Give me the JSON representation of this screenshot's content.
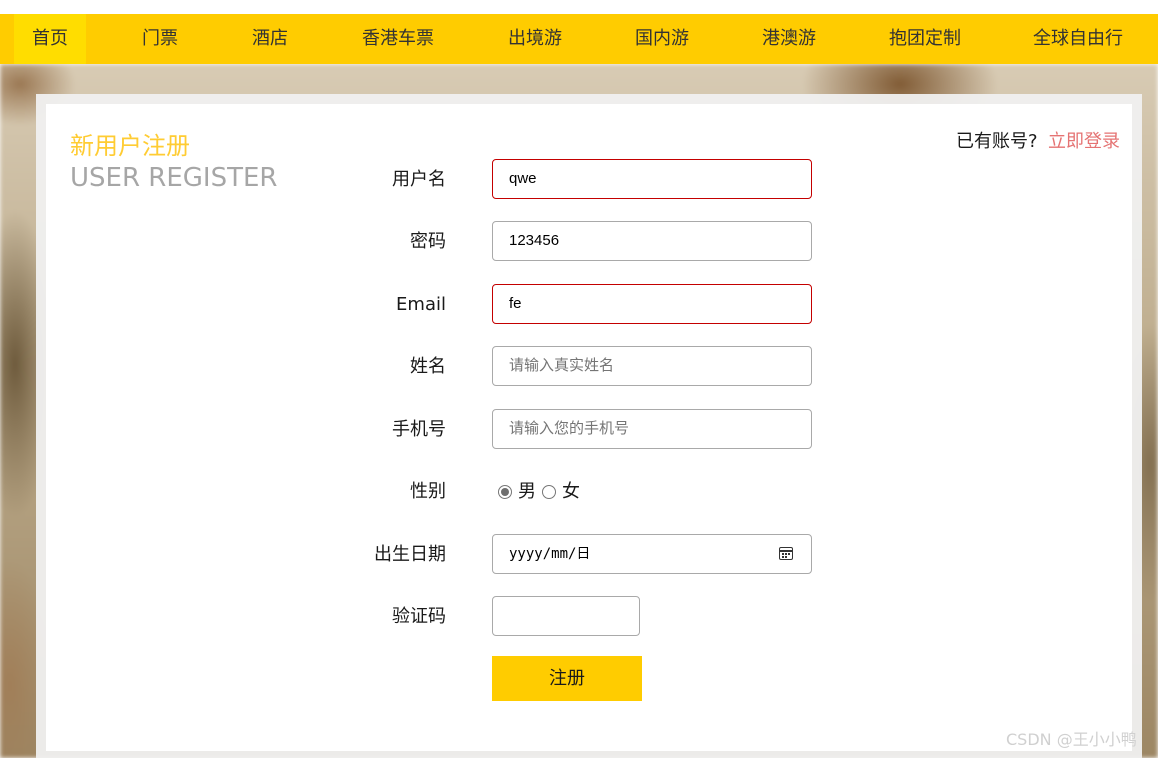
{
  "nav": {
    "items": [
      {
        "label": "首页",
        "active": true
      },
      {
        "label": "门票"
      },
      {
        "label": "酒店"
      },
      {
        "label": "香港车票"
      },
      {
        "label": "出境游"
      },
      {
        "label": "国内游"
      },
      {
        "label": "港澳游"
      },
      {
        "label": "抱团定制"
      },
      {
        "label": "全球自由行"
      }
    ]
  },
  "register": {
    "title_cn": "新用户注册",
    "title_en": "USER REGISTER",
    "login_prompt": "已有账号?",
    "login_link": "立即登录",
    "fields": {
      "username": {
        "label": "用户名",
        "value": "qwe"
      },
      "password": {
        "label": "密码",
        "value": "123456"
      },
      "email": {
        "label": "Email",
        "value": "fe"
      },
      "name": {
        "label": "姓名",
        "placeholder": "请输入真实姓名"
      },
      "phone": {
        "label": "手机号",
        "placeholder": "请输入您的手机号"
      },
      "gender": {
        "label": "性别",
        "options": [
          "男",
          "女"
        ],
        "selected": "男"
      },
      "birthday": {
        "label": "出生日期",
        "placeholder": "yyyy/mm/日"
      },
      "captcha": {
        "label": "验证码",
        "value": ""
      }
    },
    "submit_label": "注册"
  },
  "watermark": "CSDN @王小小鸭",
  "colors": {
    "nav_bg": "#ffcc00",
    "title_cn": "#ffcc33",
    "title_en": "#a6a6a6",
    "login_link": "#e57373",
    "error_border": "#c40000",
    "submit_bg": "#ffcc00"
  }
}
